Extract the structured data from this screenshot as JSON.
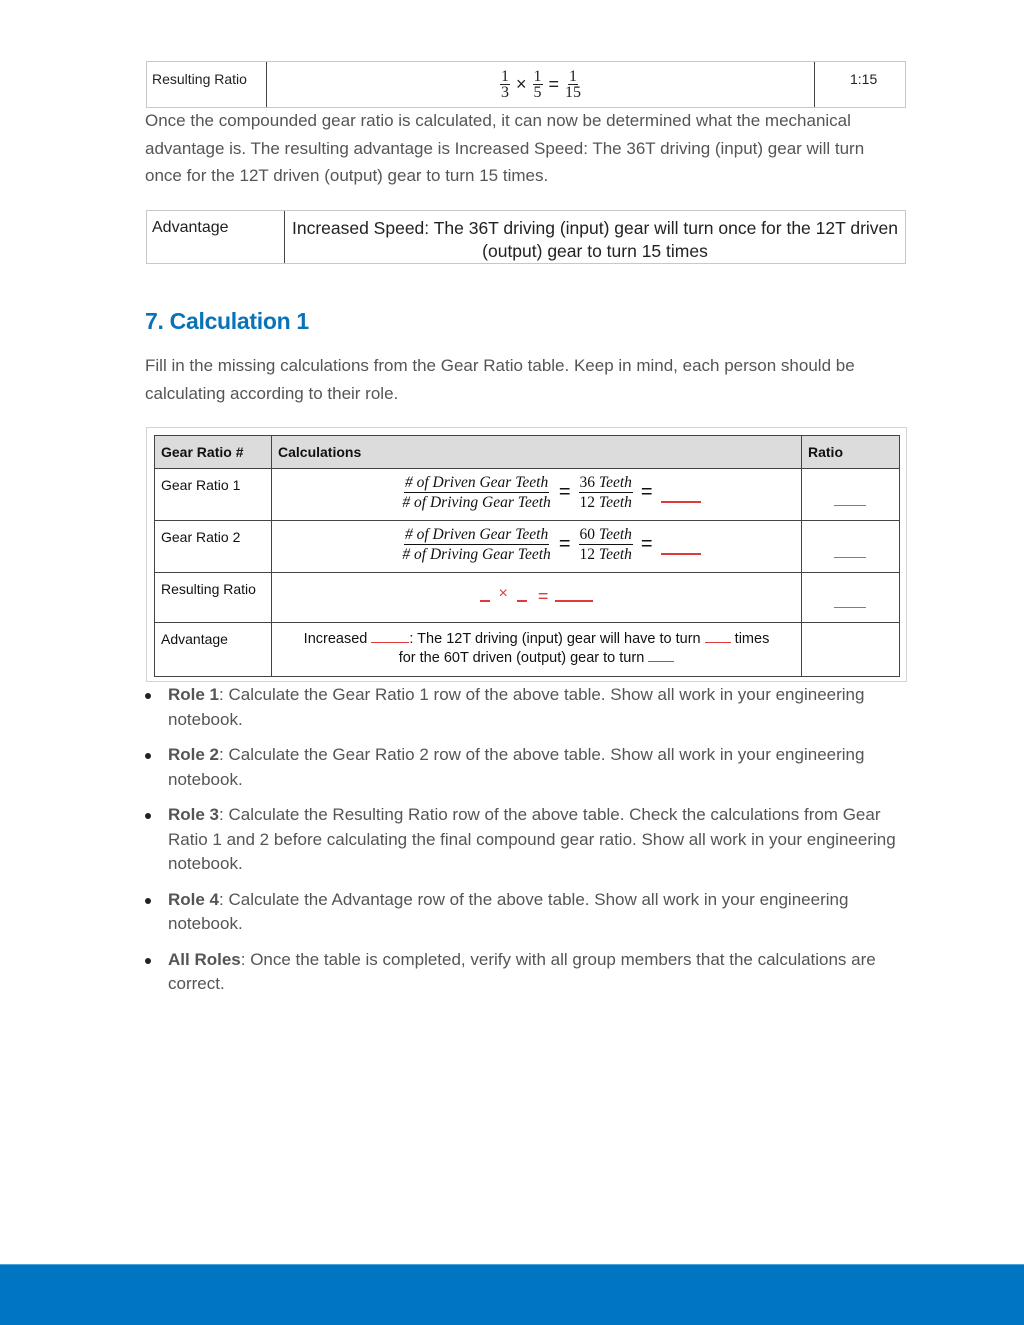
{
  "colors": {
    "heading": "#0a73b8",
    "blank_red": "#e03a3a",
    "footer": "#0075c2",
    "table_header_bg": "#dcdcdc"
  },
  "result_table": {
    "label": "Resulting Ratio",
    "fractions": [
      {
        "num": "1",
        "den": "3"
      },
      {
        "num": "1",
        "den": "5"
      },
      {
        "num": "1",
        "den": "15"
      }
    ],
    "times": "×",
    "equals": "=",
    "ratio": "1:15"
  },
  "intro_paragraph": "Once the compounded gear ratio is calculated, it can now be determined what the mechanical advantage is. The resulting advantage is Increased Speed: The 36T driving (input) gear will turn once for the 12T driven (output) gear to turn 15 times.",
  "advantage_table": {
    "label": "Advantage",
    "text": "Increased Speed: The 36T driving (input) gear will turn once for the 12T driven (output) gear to turn 15 times"
  },
  "section": {
    "heading": "7. Calculation 1",
    "instruction": "Fill in the missing calculations from the Gear Ratio table. Keep in mind, each person should be calculating according to their role."
  },
  "calc_table": {
    "headers": [
      "Gear Ratio #",
      "Calculations",
      "Ratio"
    ],
    "rows": [
      {
        "label": "Gear Ratio 1",
        "formula_num": "# of Driven Gear Teeth",
        "formula_den": "# of Driving Gear Teeth",
        "value_num": "36",
        "value_den": "12",
        "unit": "Teeth"
      },
      {
        "label": "Gear Ratio 2",
        "formula_num": "# of Driven Gear Teeth",
        "formula_den": "# of Driving Gear Teeth",
        "value_num": "60",
        "value_den": "12",
        "unit": "Teeth"
      }
    ],
    "resulting": {
      "label": "Resulting Ratio",
      "times": "×",
      "equals": "="
    },
    "advantage": {
      "label": "Advantage",
      "part1": "Increased ",
      "part2": ": The 12T driving (input) gear will have to turn ",
      "part3": " times",
      "part4": "for the 60T driven (output) gear to turn "
    },
    "equals": "="
  },
  "roles": [
    {
      "title": "Role 1",
      "text": ": Calculate the Gear Ratio 1 row of the above table. Show all work in your engineering notebook."
    },
    {
      "title": "Role 2",
      "text": ": Calculate the Gear Ratio 2 row of the above table. Show all work in your engineering notebook."
    },
    {
      "title": "Role 3",
      "text": ": Calculate the Resulting Ratio row of the above table. Check the calculations from Gear Ratio 1 and 2 before calculating the final compound gear ratio. Show all work in your engineering notebook."
    },
    {
      "title": "Role 4",
      "text": ": Calculate the Advantage row of the above table. Show all work in your engineering notebook."
    },
    {
      "title": "All Roles",
      "text": ": Once the table is completed, verify with all group members that the calculations are correct."
    }
  ]
}
